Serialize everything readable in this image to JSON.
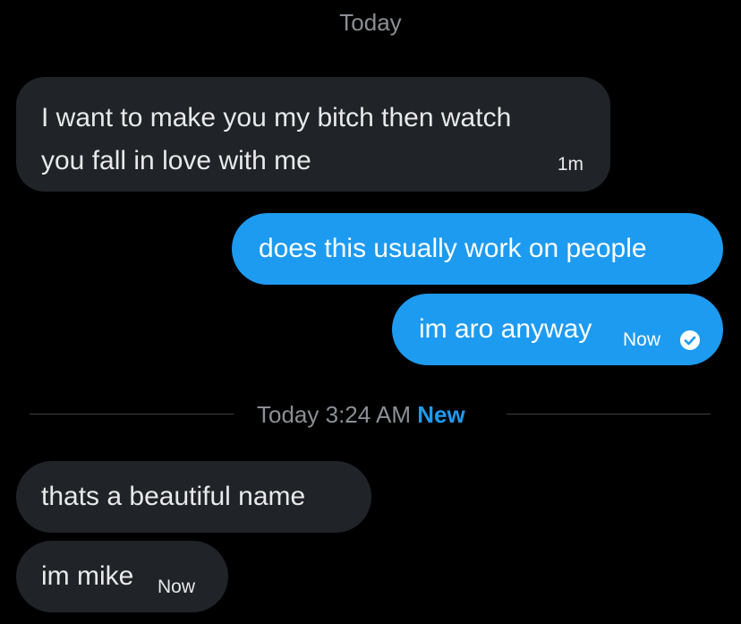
{
  "conversation": {
    "date_header": "Today",
    "messages": [
      {
        "direction": "incoming",
        "lines": [
          "I want to make you my bitch then watch",
          "you fall in love with me"
        ],
        "timestamp": "1m"
      },
      {
        "direction": "outgoing",
        "text": "does this usually work on people"
      },
      {
        "direction": "outgoing",
        "text": "im aro anyway",
        "timestamp": "Now",
        "status_icon": "read-check-icon"
      }
    ],
    "divider": {
      "label": "Today 3:24 AM",
      "badge": "New"
    },
    "new_messages": [
      {
        "direction": "incoming",
        "text": "thats a beautiful name"
      },
      {
        "direction": "incoming",
        "text": "im mike",
        "timestamp": "Now"
      }
    ]
  },
  "colors": {
    "background": "#000000",
    "incoming_bubble": "#202327",
    "outgoing_bubble": "#1d9bf0",
    "muted_text": "#8b8f94",
    "accent": "#1d9bf0"
  }
}
